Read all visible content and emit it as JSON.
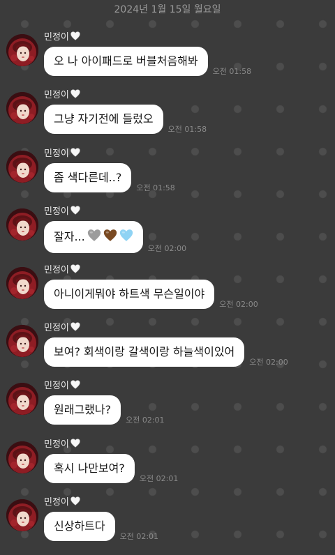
{
  "chat": {
    "date": "2024년 1월 15일 월요일",
    "sender": "민정이",
    "messages": [
      {
        "text": "오 나 아이패드로 버블처음해봐",
        "time": "오전 01:58"
      },
      {
        "text": "그냥 자기전에 들렀오",
        "time": "오전 01:58"
      },
      {
        "text": "좀 색다른데..?",
        "time": "오전 01:58"
      },
      {
        "text": "잘자...",
        "time": "오전 02:00",
        "emoji_hearts": [
          "grey-heart",
          "brown-heart",
          "light-blue-heart"
        ]
      },
      {
        "text": "아니이게뭐야 하트색 무슨일이야",
        "time": "오전 02:00"
      },
      {
        "text": "보여? 회색이랑 갈색이랑 하늘색이있어",
        "time": "오전 02:00"
      },
      {
        "text": "원래그랬나?",
        "time": "오전 02:01"
      },
      {
        "text": "혹시 나만보여?",
        "time": "오전 02:01"
      },
      {
        "text": "신상하트다",
        "time": "오전 02:01"
      }
    ]
  },
  "colors": {
    "background": "#3b3b3b",
    "bubble": "#ffffff",
    "timestamp": "#8a8a8a",
    "grey_heart": "#9c9c9c",
    "brown_heart": "#7a4a22",
    "light_blue_heart": "#8fd3f4"
  },
  "icons": {
    "sender_badge": "white-heart-icon",
    "avatar": "profile-avatar"
  }
}
